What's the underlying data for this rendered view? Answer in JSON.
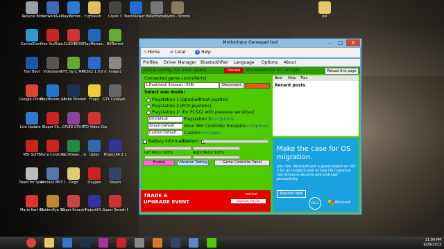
{
  "window": {
    "title": "MotioninJoy Gamepad tool",
    "toolbar": {
      "home": "Home",
      "local": "Local",
      "help": "Help"
    },
    "menus": [
      "Profiles",
      "Driver Manager",
      "BluetoothPair",
      "Language",
      "Options",
      "About"
    ],
    "strip_text": "Quick config for your game",
    "donate": "Donate",
    "recommend": "Recommend BT dongle",
    "reload": "Reload this page",
    "connected_label": "Connected game controller(s):",
    "controller_value": "1.Dualshock 3/sixaxis (USB)",
    "disconnect": "Disconnect",
    "select_mode": "Select one mode:",
    "modes": [
      "Playstation 1 (Dpad,without joystick)",
      "Playstation 2 (POV,joysticks)",
      "Playstation 2' (for PCSX2 with pressure sensitive)"
    ],
    "presets": [
      {
        "select": "DX-Default",
        "label": "Playstation 3",
        "link": "=>Options"
      },
      {
        "select": "Xinput-Default",
        "label": "Xbox 360 Controller Emulator",
        "link": "=>Options"
      },
      {
        "select": "Custom-Default",
        "label": "Custom",
        "link": "=>Create"
      }
    ],
    "battery_label": "Battery information",
    "custom_label": "Custom",
    "left_motor": "Left Motor:100%",
    "right_motor": "Right Motor:100%",
    "enable": "Enable",
    "vibration": "Vibration Testing",
    "game_panel": "Game Controller Panel",
    "right_tabs": [
      "Best",
      "Help",
      "Tips"
    ],
    "recent_posts": "Recent posts",
    "ad_ms": {
      "headline": "Make the case for OS migration.",
      "body": "Join Dell, Microsoft and a guest expert on Oct 2 for an in-depth look at how OS migration can enhance security and end-user productivity.",
      "register": "Register Now",
      "dell": "DELL",
      "microsoft": "Microsoft"
    },
    "ad_trade": {
      "line1": "TRADE &",
      "line2": "UPGRADE EVENT",
      "brand": "verizon",
      "approve": "approval may be required"
    }
  },
  "desktop_icons": [
    {
      "label": "Recycle Bin",
      "color": "#9aa0a6"
    },
    {
      "label": "NetworkGe...",
      "color": "#3d6bb3"
    },
    {
      "label": "PlayMemor... Home Help",
      "color": "#2b7bd0"
    },
    {
      "label": "gmaush",
      "color": "#e0c060"
    },
    {
      "label": "Crysis 3",
      "color": "#444444"
    },
    {
      "label": "TeamViewer 8",
      "color": "#1f6fd1"
    },
    {
      "label": "Warframe",
      "color": "#777777"
    },
    {
      "label": "Kyoto - Shonin-in",
      "color": "#8a7a60"
    },
    {
      "label": "ControlCen...",
      "color": "#3399cc"
    },
    {
      "label": "Free YouTube...",
      "color": "#cc2222"
    },
    {
      "label": "CLICKBOSS",
      "color": "#cc3333"
    },
    {
      "label": "PlayMemor...",
      "color": "#2266bb"
    },
    {
      "label": "BitTorrent",
      "color": "#66aa33"
    },
    {
      "label": "Fast Boot",
      "color": "#2255aa"
    },
    {
      "label": "VideoGene",
      "color": "#555555"
    },
    {
      "label": "HTC Sync Manager",
      "color": "#66aa33"
    },
    {
      "label": "PCSX2 1.0.0 (r5350)",
      "color": "#3366cc"
    },
    {
      "label": "Image1",
      "color": "#888888"
    },
    {
      "label": "Google Chrome",
      "color": "#dd4433"
    },
    {
      "label": "PlayMemor... Home",
      "color": "#2277cc"
    },
    {
      "label": "Adobe Photoshop...",
      "color": "#1a3355"
    },
    {
      "label": "Frapu",
      "color": "#eecc33"
    },
    {
      "label": "GTX Catalyst...",
      "color": "#666666"
    },
    {
      "label": "Live Update 5",
      "color": "#3377cc"
    },
    {
      "label": "Super-Ch...",
      "color": "#cc2222"
    },
    {
      "label": "CPUID CPU-Z",
      "color": "#884499"
    },
    {
      "label": "YTD Video Downloader",
      "color": "#cc3333"
    },
    {
      "label": "MSI SUITE",
      "color": "#cc2222"
    },
    {
      "label": "Avira Control Center",
      "color": "#cc2222"
    },
    {
      "label": "TechPower... GPU-Z",
      "color": "#228844"
    },
    {
      "label": "Uplay",
      "color": "#3366aa"
    },
    {
      "label": "Project64 2.1",
      "color": "#333399"
    },
    {
      "label": "Need for Speed Mo...",
      "color": "#bbbbbb"
    },
    {
      "label": "Aircrack MP3 Converter",
      "color": "#5577aa"
    },
    {
      "label": "Oxgo",
      "color": "#ddcc77"
    },
    {
      "label": "Oxygen",
      "color": "#cc2222"
    },
    {
      "label": "Steam",
      "color": "#334466"
    },
    {
      "label": "Mario Kart 64",
      "color": "#dd3333"
    },
    {
      "label": "GoldenEye 007",
      "color": "#bb8833"
    },
    {
      "label": "Super Smash Bro...",
      "color": "#cc4444"
    },
    {
      "label": "Project64...",
      "color": "#333399"
    },
    {
      "label": "Super Smash Bros...",
      "color": "#cc3333"
    }
  ],
  "taskbar": {
    "time": "11:09 PM",
    "date": "9/29/2013"
  }
}
